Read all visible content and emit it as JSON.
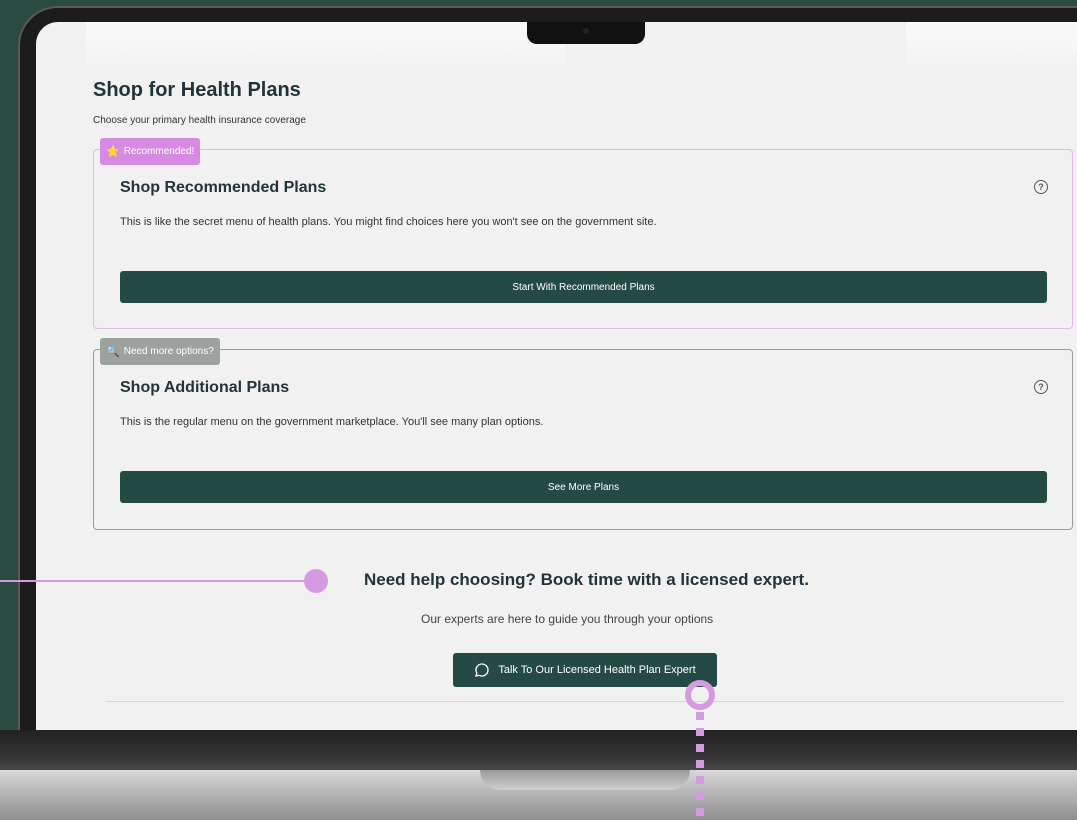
{
  "page": {
    "title": "Shop for Health Plans",
    "subtitle": "Choose your primary health insurance coverage"
  },
  "recommended": {
    "badge": "Recommended!",
    "badge_icon": "star-icon",
    "title": "Shop Recommended Plans",
    "description": "This is like the secret menu of health plans. You might find choices here you won't see on the government site.",
    "button": "Start With Recommended Plans",
    "help_glyph": "?"
  },
  "additional": {
    "badge": "Need more options?",
    "badge_icon": "magnifier-icon",
    "title": "Shop Additional Plans",
    "description": "This is the regular menu on the government marketplace. You'll see many plan options.",
    "button": "See More Plans",
    "help_glyph": "?"
  },
  "help": {
    "title": "Need help choosing? Book time with a licensed expert.",
    "subtitle": "Our experts are here to guide you through your options",
    "button": "Talk To Our Licensed Health Plan Expert",
    "button_icon": "chat-bubble-icon"
  },
  "colors": {
    "primary": "#244b43",
    "recommended_badge": "#d78ae2",
    "additional_badge": "#9da29f",
    "annotation": "#d59be0",
    "background": "#2a4a42"
  }
}
